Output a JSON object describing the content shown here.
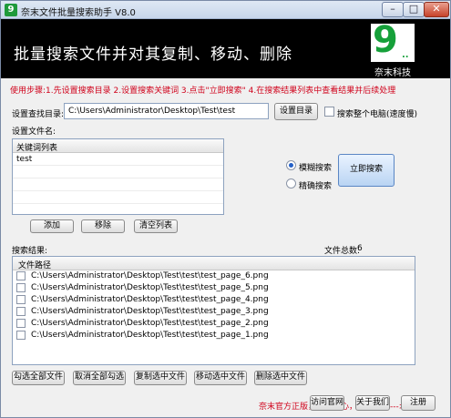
{
  "window": {
    "title": "奈末文件批量搜索助手 V8.0",
    "icon_text": "9",
    "minimize": "–",
    "maximize": "□",
    "close": "✕"
  },
  "banner": {
    "title": "批量搜索文件并对其复制、移动、删除",
    "logo_text": "9",
    "logo_dots": "..",
    "company": "奈末科技"
  },
  "steps": "使用步骤:1.先设置搜索目录 2.设置搜索关键词 3.点击\"立即搜索\" 4.在搜索结果列表中查看结果并后续处理",
  "search_dir": {
    "label": "设置查找目录:",
    "value": "C:\\Users\\Administrator\\Desktop\\Test\\test",
    "button": "设置目录",
    "whole_pc_label": "搜索整个电脑(速度慢)"
  },
  "filename": {
    "label": "设置文件名:",
    "list_header": "关键词列表",
    "keywords": [
      "test",
      "",
      "",
      "",
      "",
      ""
    ],
    "add_button": "添加",
    "remove_button": "移除",
    "clear_button": "清空列表"
  },
  "search_mode": {
    "fuzzy_label": "模糊搜索",
    "exact_label": "精确搜索",
    "search_button": "立即搜索"
  },
  "results": {
    "label": "搜索结果:",
    "count_label": "文件总数:",
    "count": "6",
    "column_header": "文件路径",
    "rows": [
      "C:\\Users\\Administrator\\Desktop\\Test\\test\\test_page_6.png",
      "C:\\Users\\Administrator\\Desktop\\Test\\test\\test_page_5.png",
      "C:\\Users\\Administrator\\Desktop\\Test\\test\\test_page_4.png",
      "C:\\Users\\Administrator\\Desktop\\Test\\test\\test_page_3.png",
      "C:\\Users\\Administrator\\Desktop\\Test\\test\\test_page_2.png",
      "C:\\Users\\Administrator\\Desktop\\Test\\test\\test_page_1.png"
    ]
  },
  "actions": {
    "select_all": "勾选全部文件",
    "deselect_all": "取消全部勾选",
    "copy_selected": "复制选中文件",
    "move_selected": "移动选中文件",
    "delete_selected": "删除选中文件"
  },
  "footer": {
    "promo": "奈末官方正版，安全放心，官方下载--->",
    "visit_site": "访问官网",
    "about": "关于我们",
    "register": "注册"
  }
}
